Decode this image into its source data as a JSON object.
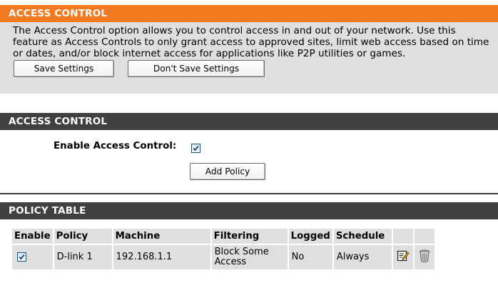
{
  "intro": {
    "header": "ACCESS CONTROL",
    "description": "The Access Control option allows you to control access in and out of your network. Use this feature as Access Controls to only grant access to approved sites, limit web access based on time or dates, and/or block internet access for applications like P2P utilities or games.",
    "save_label": "Save Settings",
    "dont_save_label": "Don't Save Settings"
  },
  "access": {
    "header": "ACCESS CONTROL",
    "enable_label": "Enable Access Control:",
    "enable_checked": true,
    "add_policy_label": "Add Policy"
  },
  "policy_table": {
    "header": "POLICY TABLE",
    "columns": [
      "Enable",
      "Policy",
      "Machine",
      "Filtering",
      "Logged",
      "Schedule",
      "",
      ""
    ],
    "rows": [
      {
        "enabled": true,
        "policy": "D-link 1",
        "machine": "192.168.1.1",
        "filtering": "Block Some Access",
        "logged": "No",
        "schedule": "Always",
        "edit_icon": "edit-icon",
        "delete_icon": "trash-icon"
      }
    ]
  },
  "colors": {
    "orange_header": "#f47920",
    "dark_header": "#404040",
    "panel_gray": "#dfdfdf"
  }
}
